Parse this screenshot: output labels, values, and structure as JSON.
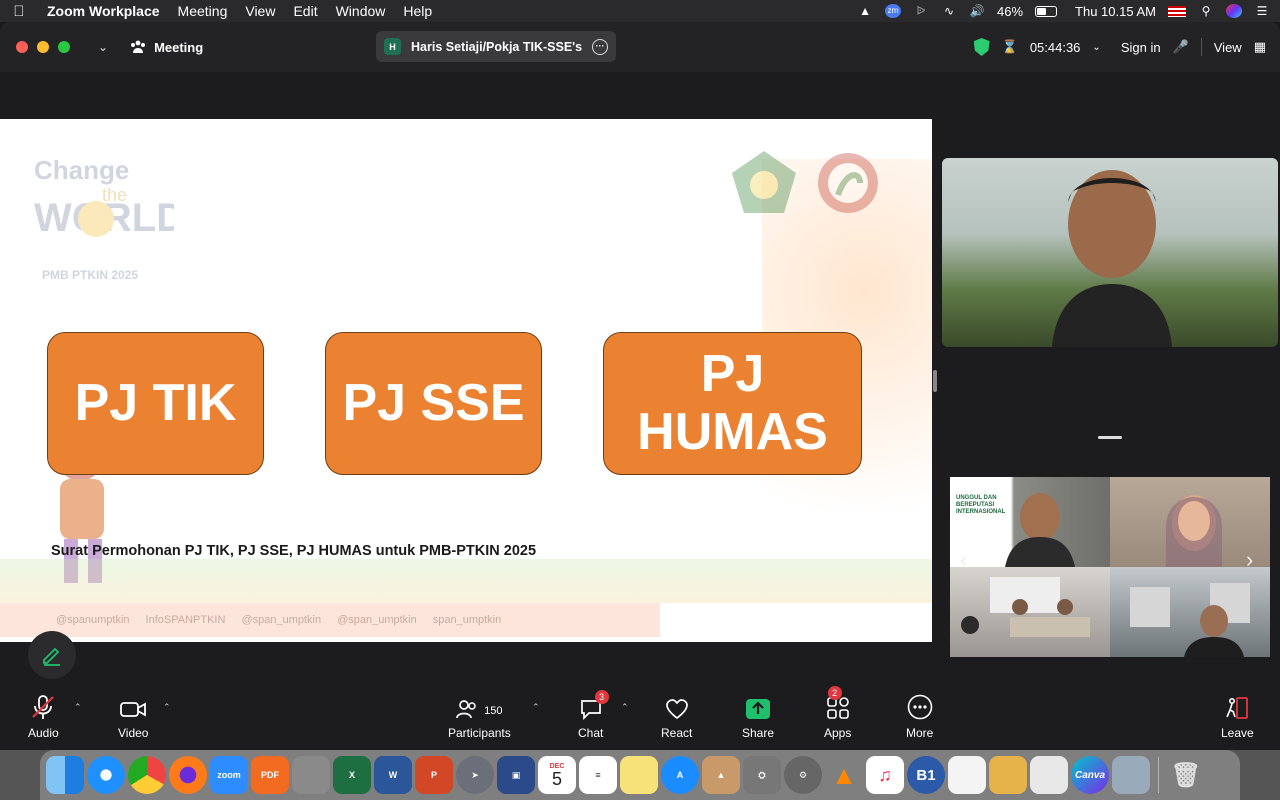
{
  "menubar": {
    "app_name": "Zoom Workplace",
    "menus": [
      "Meeting",
      "View",
      "Edit",
      "Window",
      "Help"
    ],
    "battery": "46%",
    "clock": "Thu 10.15 AM"
  },
  "titlebar": {
    "meeting_label": "Meeting",
    "share_title": "Haris Setiaji/Pokja TIK-SSE's",
    "share_initial": "H",
    "timer": "05:44:36",
    "sign_in": "Sign in",
    "view": "View"
  },
  "slide": {
    "boxes": [
      "PJ TIK",
      "PJ SSE",
      "PJ\nHUMAS"
    ],
    "caption": "Surat Permohonan PJ TIK, PJ SSE, PJ HUMAS untuk PMB-PTKIN 2025",
    "social": [
      "@spanumptkin",
      "InfoSPANPTKIN",
      "@span_umptkin",
      "@span_umptkin",
      "span_umptkin"
    ]
  },
  "toolbar": {
    "audio": "Audio",
    "video": "Video",
    "participants": "Participants",
    "participants_count": "150",
    "chat": "Chat",
    "chat_badge": "3",
    "react": "React",
    "share": "Share",
    "apps": "Apps",
    "apps_badge": "2",
    "more": "More",
    "leave": "Leave"
  },
  "gallery": {
    "tile1_text": "UNGGUL DAN BEREPUTASI INTERNASIONAL"
  },
  "dock": {
    "calendar_month": "DEC",
    "calendar_day": "5",
    "apps": [
      "Finder",
      "Safari",
      "Chrome",
      "Firefox",
      "Zoom",
      "PDF",
      "Calculator",
      "Excel",
      "Word",
      "PowerPoint",
      "Launchpad",
      "Notes",
      "Calendar",
      "Reminders",
      "Stickies",
      "App Store",
      "Preview",
      "Utility",
      "Settings",
      "VLC",
      "Music",
      "B1",
      "TextEdit",
      "Books",
      "Script",
      "Canva",
      "Photos",
      "Trash"
    ]
  },
  "colors": {
    "box_orange": "#ea8231",
    "box_border": "#6e3e17",
    "share_green": "#1fbf6b",
    "badge_red": "#e0383e"
  }
}
